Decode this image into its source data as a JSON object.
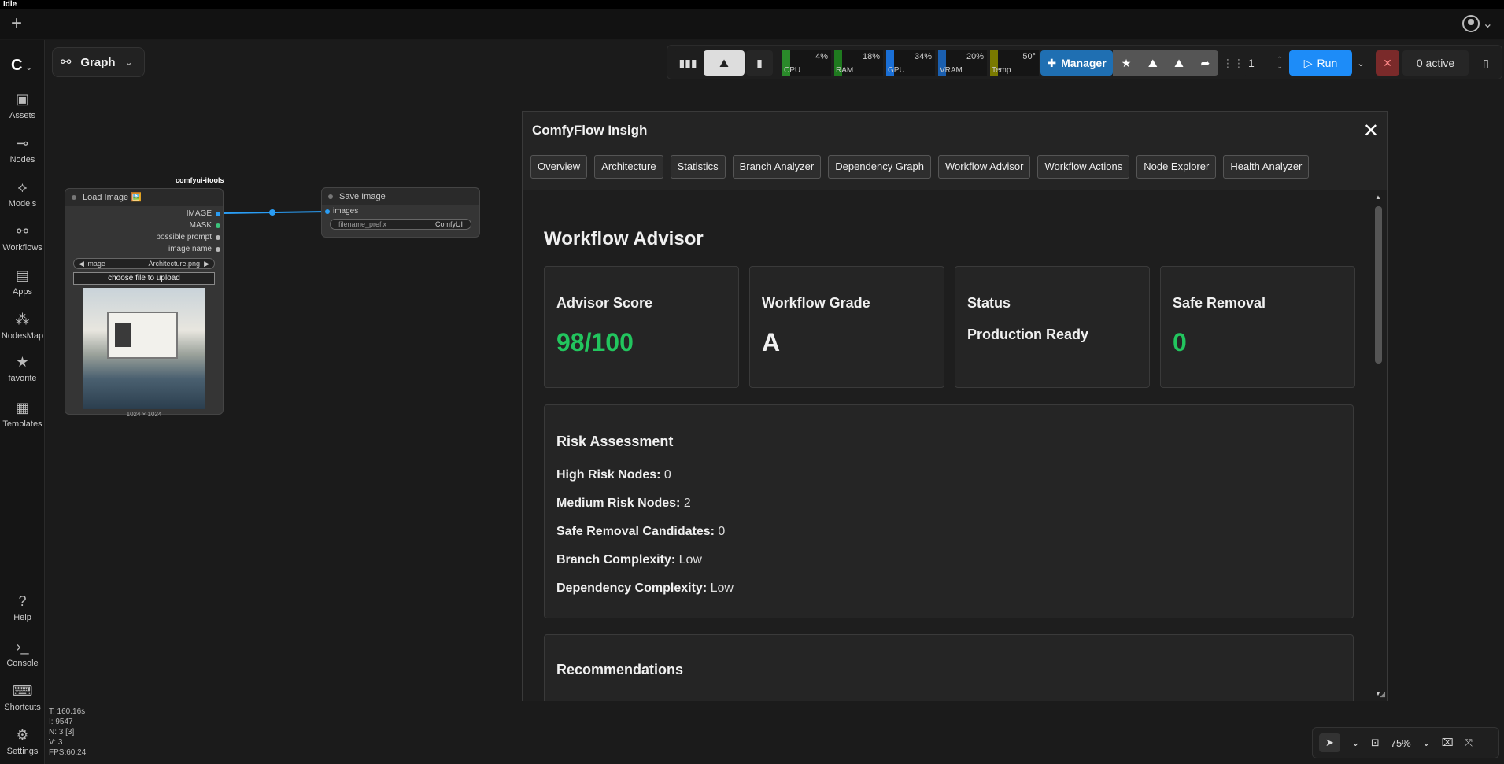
{
  "titlebar": {
    "status": "Idle"
  },
  "tabbar": {
    "new_tab": "+",
    "user_chevron": "⌄"
  },
  "sidebar": {
    "logo": "C",
    "items": [
      {
        "label": "Assets",
        "icon": "image-icon"
      },
      {
        "label": "Nodes",
        "icon": "nodes-icon"
      },
      {
        "label": "Models",
        "icon": "models-icon"
      },
      {
        "label": "Workflows",
        "icon": "workflows-icon"
      },
      {
        "label": "Apps",
        "icon": "apps-icon"
      },
      {
        "label": "NodesMap",
        "icon": "nodesmap-icon"
      },
      {
        "label": "favorite",
        "icon": "star-icon"
      },
      {
        "label": "Templates",
        "icon": "templates-icon"
      }
    ],
    "bottom_items": [
      {
        "label": "Help",
        "icon": "help-icon"
      },
      {
        "label": "Console",
        "icon": "console-icon"
      },
      {
        "label": "Shortcuts",
        "icon": "keyboard-icon"
      },
      {
        "label": "Settings",
        "icon": "gear-icon"
      }
    ]
  },
  "graph_menu": {
    "label": "Graph"
  },
  "toolbar": {
    "meters": [
      {
        "label": "CPU",
        "value": "4%",
        "color": "#2a8a2a",
        "fill": 0.04
      },
      {
        "label": "RAM",
        "value": "18%",
        "color": "#1f7a1f",
        "fill": 0.18
      },
      {
        "label": "GPU",
        "value": "34%",
        "color": "#1a6fd6",
        "fill": 0.34
      },
      {
        "label": "VRAM",
        "value": "20%",
        "color": "#1a5fb0",
        "fill": 0.2
      },
      {
        "label": "Temp",
        "value": "50°",
        "color": "#7a7a00",
        "fill": 0.5
      }
    ],
    "manager_label": "Manager",
    "queue_count": "1",
    "run_label": "Run",
    "active_label": "0 active"
  },
  "nodes": {
    "load_image": {
      "group_label": "comfyui-itools",
      "title": "Load Image 🖼️",
      "outputs": [
        "IMAGE",
        "MASK",
        "possible prompt",
        "image name"
      ],
      "image_widget_label": "image",
      "image_widget_value": "Architecture.png",
      "upload_label": "choose file to upload",
      "dims": "1024 × 1024"
    },
    "save_image": {
      "title": "Save Image",
      "input": "images",
      "widget_label": "filename_prefix",
      "widget_value": "ComfyUI"
    }
  },
  "modal": {
    "title": "ComfyFlow Insigh",
    "close": "✕",
    "tabs": [
      "Overview",
      "Architecture",
      "Statistics",
      "Branch Analyzer",
      "Dependency Graph",
      "Workflow Advisor",
      "Workflow Actions",
      "Node Explorer",
      "Health Analyzer"
    ],
    "heading": "Workflow Advisor",
    "cards": [
      {
        "title": "Advisor Score",
        "value": "98/100",
        "color": "#22c55e"
      },
      {
        "title": "Workflow Grade",
        "value": "A",
        "color": "#f0f0f0"
      },
      {
        "title": "Status",
        "value": "Production Ready",
        "color": "#f0f0f0"
      },
      {
        "title": "Safe Removal",
        "value": "0",
        "color": "#22c55e"
      }
    ],
    "risk": {
      "title": "Risk Assessment",
      "rows": [
        {
          "label": "High Risk Nodes:",
          "value": "0"
        },
        {
          "label": "Medium Risk Nodes:",
          "value": "2"
        },
        {
          "label": "Safe Removal Candidates:",
          "value": "0"
        },
        {
          "label": "Branch Complexity:",
          "value": "Low"
        },
        {
          "label": "Dependency Complexity:",
          "value": "Low"
        }
      ]
    },
    "recommendations_title": "Recommendations"
  },
  "stats": {
    "lines": [
      "T: 160.16s",
      "I: 9547",
      "N: 3 [3]",
      "V: 3",
      "FPS:60.24"
    ]
  },
  "bottom_tools": {
    "zoom": "75%"
  }
}
